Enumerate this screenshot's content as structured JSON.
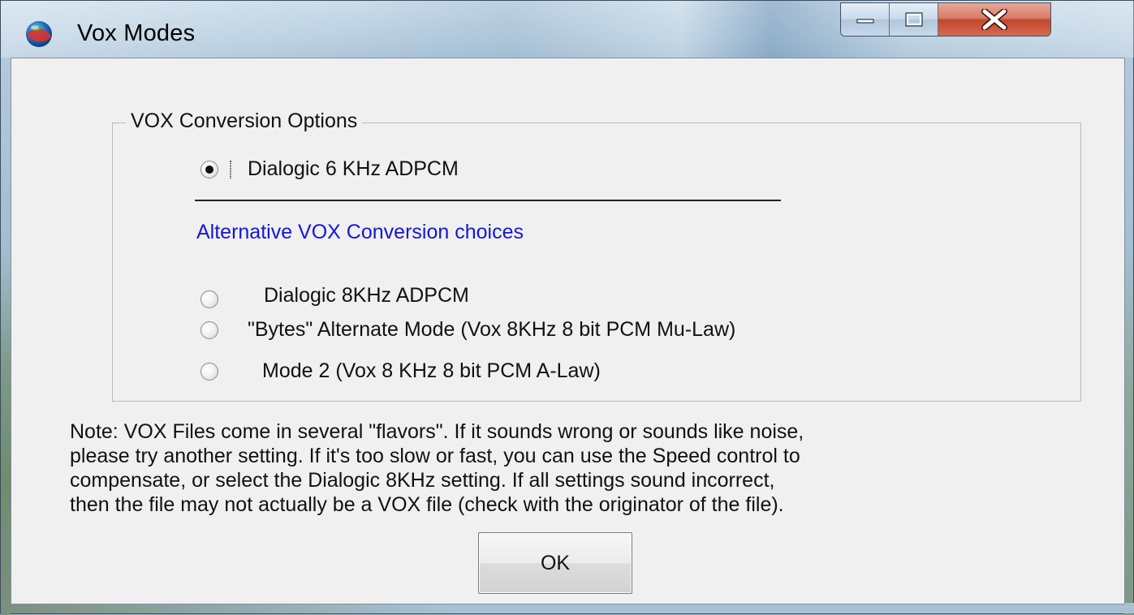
{
  "window": {
    "title": "Vox Modes",
    "caption_buttons": {
      "minimize_icon": "minimize-icon",
      "maximize_icon": "maximize-icon",
      "close_icon": "close-icon"
    }
  },
  "group": {
    "legend": "VOX Conversion Options",
    "primary_option": {
      "label": "Dialogic 6 KHz ADPCM",
      "selected": true
    },
    "alternative_label": "Alternative VOX Conversion choices",
    "alternatives": [
      {
        "label": "Dialogic  8KHz ADPCM",
        "selected": false
      },
      {
        "label": "\"Bytes\" Alternate Mode (Vox 8KHz 8 bit PCM Mu-Law)",
        "selected": false
      },
      {
        "label": "Mode 2 (Vox 8 KHz 8 bit PCM A-Law)",
        "selected": false
      }
    ]
  },
  "note": {
    "lines": [
      "Note: VOX Files come in several \"flavors\". If it sounds wrong or sounds like noise,",
      "please try another setting. If it's too slow or fast, you can use the Speed control to",
      "compensate, or select the Dialogic 8KHz setting. If all settings sound incorrect,",
      "then the file may not actually be a VOX file (check with the originator of the file)."
    ]
  },
  "buttons": {
    "ok_label": "OK"
  },
  "colors": {
    "alternative_label": "#1616d8",
    "dialog_background": "#f0f0f0",
    "close_button": "#c2472d"
  }
}
